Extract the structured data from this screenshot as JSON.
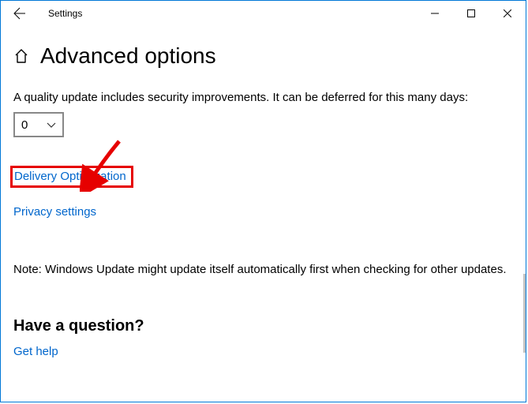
{
  "titlebar": {
    "title": "Settings"
  },
  "page": {
    "heading": "Advanced options",
    "quality_update_text": "A quality update includes security improvements. It can be deferred for this many days:",
    "defer_days_value": "0",
    "link_delivery_optimization": "Delivery Optimization",
    "link_privacy_settings": "Privacy settings",
    "note_text": "Note: Windows Update might update itself automatically first when checking for other updates.",
    "question_heading": "Have a question?",
    "link_get_help": "Get help"
  },
  "icons": {
    "back": "back-arrow",
    "home": "home-outline",
    "chevron_down": "chevron-down",
    "minimize": "minimize",
    "maximize": "maximize",
    "close": "close"
  },
  "annotation": {
    "highlight_target": "Delivery Optimization",
    "highlight_color": "#e60000"
  }
}
